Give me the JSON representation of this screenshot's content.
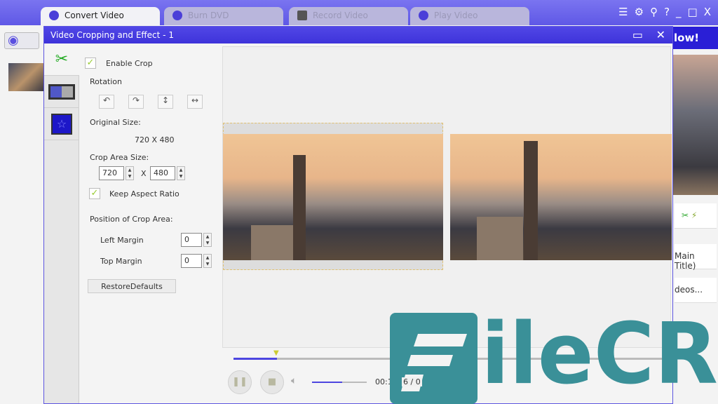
{
  "app": {
    "tabs": [
      {
        "label": "Convert Video",
        "active": true
      },
      {
        "label": "Burn DVD"
      },
      {
        "label": "Record Video"
      },
      {
        "label": "Play Video"
      }
    ],
    "window_controls": [
      "list-icon",
      "gear-icon",
      "key-icon",
      "?",
      "_",
      "□",
      "X"
    ],
    "convert_button": "low!",
    "right_rows": [
      "Main Title)",
      "deos..."
    ]
  },
  "dialog": {
    "title": "Video Cropping and Effect - 1",
    "side_tabs": [
      "crop-icon",
      "film-icon",
      "effect-star-icon"
    ],
    "enable_crop": {
      "label": "Enable Crop",
      "checked": true
    },
    "rotation_label": "Rotation",
    "rotation_buttons": [
      "rotate-left-icon",
      "rotate-right-icon",
      "flip-vertical-icon",
      "flip-horizontal-icon"
    ],
    "original_size_label": "Original Size:",
    "original_size": "720 X 480",
    "crop_area_label": "Crop Area Size:",
    "crop_width": "720",
    "crop_x": "X",
    "crop_height": "480",
    "keep_aspect": {
      "label": "Keep Aspect Ratio",
      "checked": true
    },
    "position_label": "Position of Crop Area:",
    "left_margin_label": "Left Margin",
    "left_margin": "0",
    "top_margin_label": "Top Margin",
    "top_margin": "0",
    "restore_label": "RestoreDefaults",
    "player": {
      "seek_percent": 10,
      "volume_percent": 55,
      "time_a": "00:1",
      "time_b": "6 / 0"
    }
  },
  "watermark": "FileCR",
  "colors": {
    "accent": "#4d46e0",
    "titlebar": "#4a40e2",
    "watermark": "#3a9098"
  }
}
